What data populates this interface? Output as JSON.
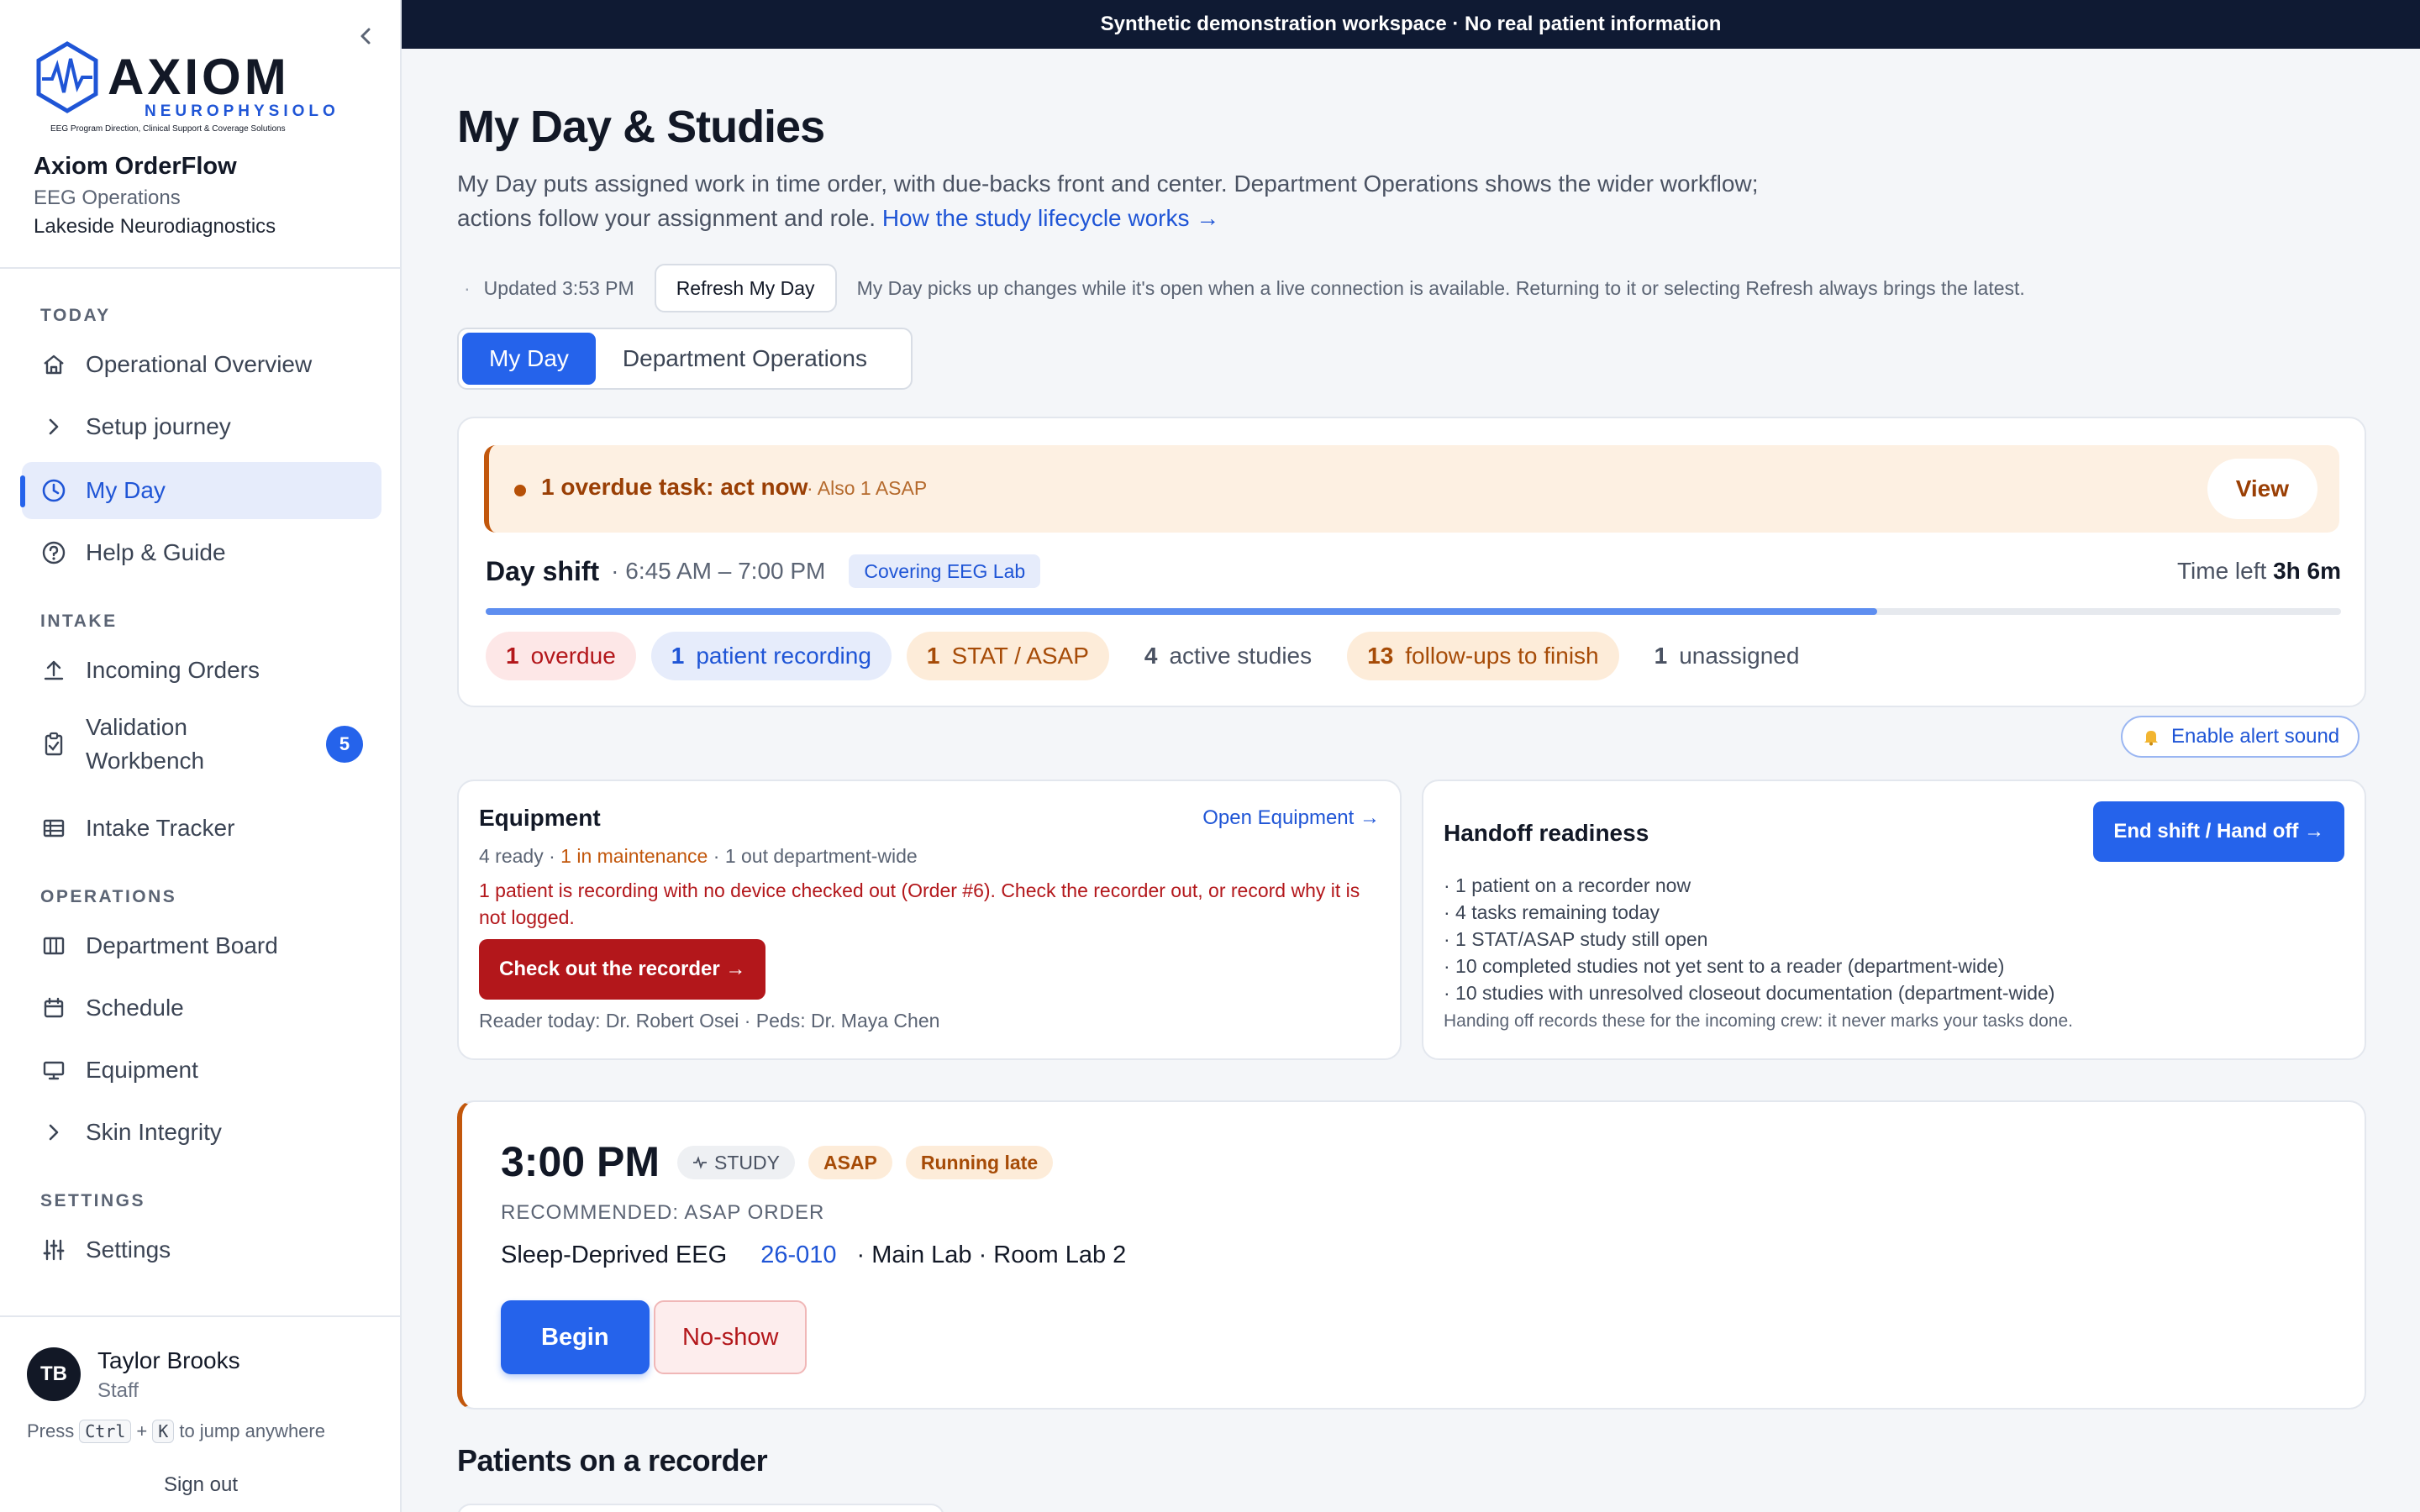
{
  "banner": "Synthetic demonstration workspace · No real patient information",
  "brand": {
    "logo_name": "AXIOM",
    "logo_sub": "NEUROPHYSIOLOGY",
    "logo_tag": "EEG Program Direction, Clinical Support & Coverage Solutions",
    "app_name": "Axiom OrderFlow",
    "dept": "EEG Operations",
    "org": "Lakeside Neurodiagnostics"
  },
  "sidebar": {
    "sections": {
      "today": "TODAY",
      "intake": "INTAKE",
      "operations": "OPERATIONS",
      "settings": "SETTINGS"
    },
    "items": {
      "overview": "Operational Overview",
      "setup": "Setup journey",
      "myday": "My Day",
      "help": "Help & Guide",
      "incoming": "Incoming Orders",
      "validation_1": "Validation",
      "validation_2": "Workbench",
      "validation_count": "5",
      "tracker": "Intake Tracker",
      "board": "Department Board",
      "schedule": "Schedule",
      "equipment": "Equipment",
      "skin": "Skin Integrity",
      "settings": "Settings"
    }
  },
  "user": {
    "initials": "TB",
    "name": "Taylor Brooks",
    "role": "Staff",
    "hint_pre": "Press",
    "key1": "Ctrl",
    "plus": "+",
    "key2": "K",
    "hint_post": "to jump anywhere",
    "signout": "Sign out"
  },
  "page": {
    "title": "My Day & Studies",
    "desc": "My Day puts assigned work in time order, with due-backs front and center. Department Operations shows the wider workflow; actions follow your assignment and role.",
    "desc_link": "How the study lifecycle works →",
    "updated": "Updated 3:53 PM",
    "refresh": "Refresh My Day",
    "refresh_note": "My Day picks up changes while it's open when a live connection is available. Returning to it or selecting Refresh always brings the latest.",
    "tab_myday": "My Day",
    "tab_dept": "Department Operations"
  },
  "alert": {
    "main": "1 overdue task: act now",
    "sub": "· Also 1 ASAP",
    "view": "View"
  },
  "shift": {
    "name": "Day shift",
    "time": "· 6:45 AM – 7:00 PM",
    "covering": "Covering EEG Lab",
    "time_left_label": "Time left",
    "time_left": "3h 6m",
    "progress": 0.75
  },
  "pills": [
    {
      "n": "1",
      "label": "overdue"
    },
    {
      "n": "1",
      "label": "patient recording"
    },
    {
      "n": "1",
      "label": "STAT / ASAP"
    },
    {
      "n": "4",
      "label": "active studies"
    },
    {
      "n": "13",
      "label": "follow-ups to finish"
    },
    {
      "n": "1",
      "label": "unassigned"
    }
  ],
  "sound_btn": "Enable alert sound",
  "equipment": {
    "title": "Equipment",
    "open": "Open Equipment →",
    "ready": "4 ready",
    "sep": " · ",
    "maint": "1 in maintenance",
    "out": "1 out department-wide",
    "warning": "1 patient is recording with no device checked out (Order #6). Check the recorder out, or record why it is not logged.",
    "checkout": "Check out the recorder →",
    "readers": "Reader today: Dr. Robert Osei · Peds: Dr. Maya Chen"
  },
  "handoff": {
    "title": "Handoff readiness",
    "button": "End shift / Hand off →",
    "items": [
      "· 1 patient on a recorder now",
      "· 4 tasks remaining today",
      "· 1 STAT/ASAP study still open",
      "· 10 completed studies not yet sent to a reader (department-wide)",
      "· 10 studies with unresolved closeout documentation (department-wide)"
    ],
    "note": "Handing off records these for the incoming crew: it never marks your tasks done."
  },
  "study": {
    "time": "3:00 PM",
    "tag_type": "STUDY",
    "tag_priority": "ASAP",
    "tag_status": "Running late",
    "recommended": "RECOMMENDED: ASAP ORDER",
    "name": "Sleep-Deprived EEG",
    "order": "26-010",
    "location": "· Main Lab · Room Lab 2",
    "begin": "Begin",
    "noshow": "No-show"
  },
  "section2": "Patients on a recorder",
  "colors": {
    "accent": "#2563eb",
    "navy": "#0f1a33",
    "danger": "#b3171b",
    "warning": "#c2570c"
  }
}
